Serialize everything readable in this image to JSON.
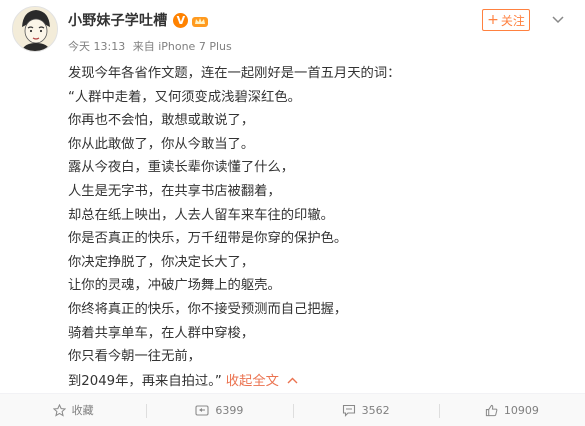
{
  "user": {
    "name": "小野妹子学吐槽",
    "verified_badge": "V",
    "time": "今天 13:13",
    "source": "来自 iPhone 7 Plus"
  },
  "follow_button": {
    "plus": "+",
    "label": "关注"
  },
  "post": {
    "lines": [
      "发现今年各省作文题，连在一起刚好是一首五月天的词：",
      "“人群中走着，又何须变成浅碧深红色。",
      "你再也不会怕，敢想或敢说了，",
      "你从此敢做了，你从今敢当了。",
      "露从今夜白，重读长辈你读懂了什么，",
      "人生是无字书，在共享书店被翻着，",
      "却总在纸上映出，人去人留车来车往的印辙。",
      "你是否真正的快乐，万千纽带是你穿的保护色。",
      "你决定挣脱了，你决定长大了，",
      "让你的灵魂，冲破广场舞上的躯壳。",
      "你终将真正的快乐，你不接受预测而自己把握，",
      "骑着共享单车，在人群中穿梭，",
      "你只看今朝一往无前，",
      "到2049年，再来自拍过。”"
    ],
    "collapse_label": "收起全文"
  },
  "actions": {
    "favorite": "收藏",
    "repost": "6399",
    "comment": "3562",
    "like": "10909"
  },
  "colors": {
    "accent": "#eb7350",
    "follow": "#ff8140",
    "verified": "#ff8200",
    "meta_text": "#808080",
    "body_text": "#333333"
  },
  "icons": {
    "favorite": "star-icon",
    "repost": "repost-icon",
    "comment": "comment-icon",
    "like": "thumbs-up-icon",
    "more": "chevron-down-icon",
    "member": "member-crown-icon"
  }
}
